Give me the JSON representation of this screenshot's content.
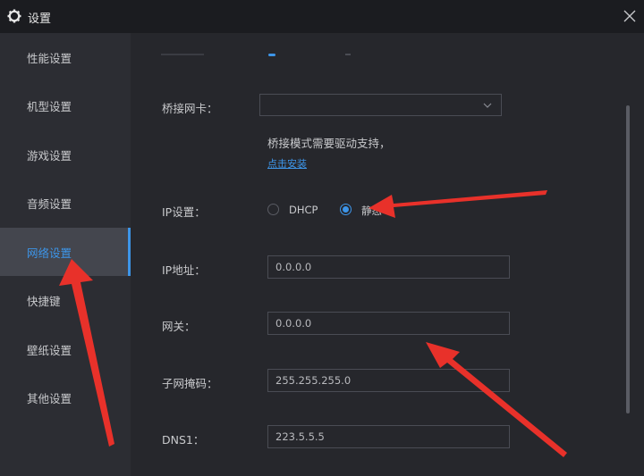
{
  "window": {
    "title": "设置",
    "icon": "gear-icon",
    "close_icon": "close-icon"
  },
  "sidebar": {
    "items": [
      {
        "label": "性能设置",
        "active": false
      },
      {
        "label": "机型设置",
        "active": false
      },
      {
        "label": "游戏设置",
        "active": false
      },
      {
        "label": "音频设置",
        "active": false
      },
      {
        "label": "网络设置",
        "active": true
      },
      {
        "label": "快捷键",
        "active": false
      },
      {
        "label": "壁纸设置",
        "active": false
      },
      {
        "label": "其他设置",
        "active": false
      }
    ]
  },
  "network": {
    "bridge_label": "桥接网卡：",
    "bridge_value": "",
    "bridge_hint": "桥接模式需要驱动支持，",
    "install_link": "点击安装",
    "ip_mode_label": "IP设置：",
    "ip_modes": [
      {
        "label": "DHCP",
        "selected": false
      },
      {
        "label": "静态",
        "selected": true
      }
    ],
    "ip_label": "IP地址：",
    "ip_value": "0.0.0.0",
    "gateway_label": "网关：",
    "gateway_value": "0.0.0.0",
    "mask_label": "子网掩码：",
    "mask_value": "255.255.255.0",
    "dns1_label": "DNS1：",
    "dns1_value": "223.5.5.5"
  },
  "colors": {
    "accent": "#3d95e8",
    "annotation_arrow": "#e8312a",
    "background": "#26272c",
    "sidebar": "#2c2d33",
    "titlebar": "#1b1c20"
  }
}
